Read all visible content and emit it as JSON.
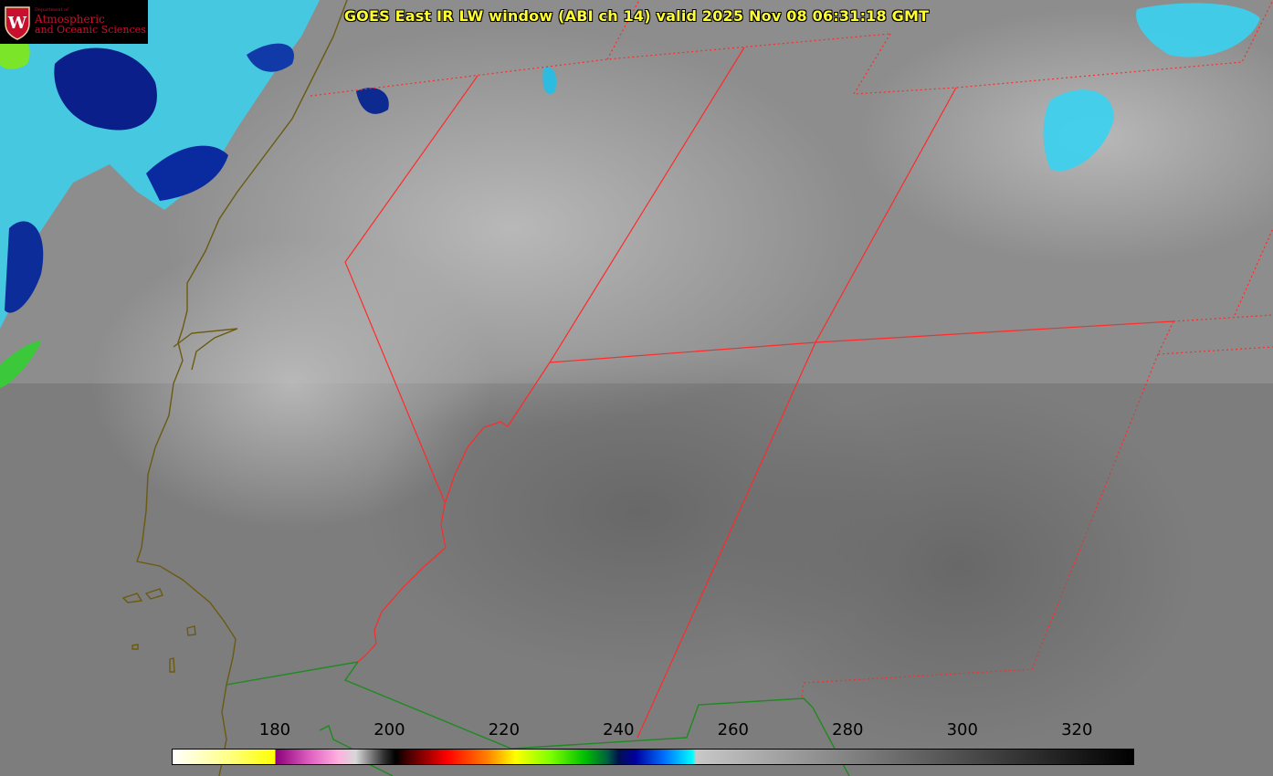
{
  "title": "GOES East IR LW window (ABI ch 14) valid 2025 Nov 08 06:31:18 GMT",
  "logo": {
    "dept_line": "Department of",
    "line1": "Atmospheric",
    "line2": "and Oceanic Sciences",
    "seal_letter": "W",
    "icon": "uw-crest-icon"
  },
  "colorbar": {
    "min": 162,
    "max": 330,
    "tick_labels": [
      "180",
      "200",
      "220",
      "240",
      "260",
      "280",
      "300",
      "320"
    ],
    "tick_values": [
      180,
      200,
      220,
      240,
      260,
      280,
      300,
      320
    ]
  },
  "colors": {
    "title": "#ffff33",
    "state_border": "#ff2a2a",
    "coast": "#6b5a10",
    "country_border": "#1f8a1f"
  }
}
